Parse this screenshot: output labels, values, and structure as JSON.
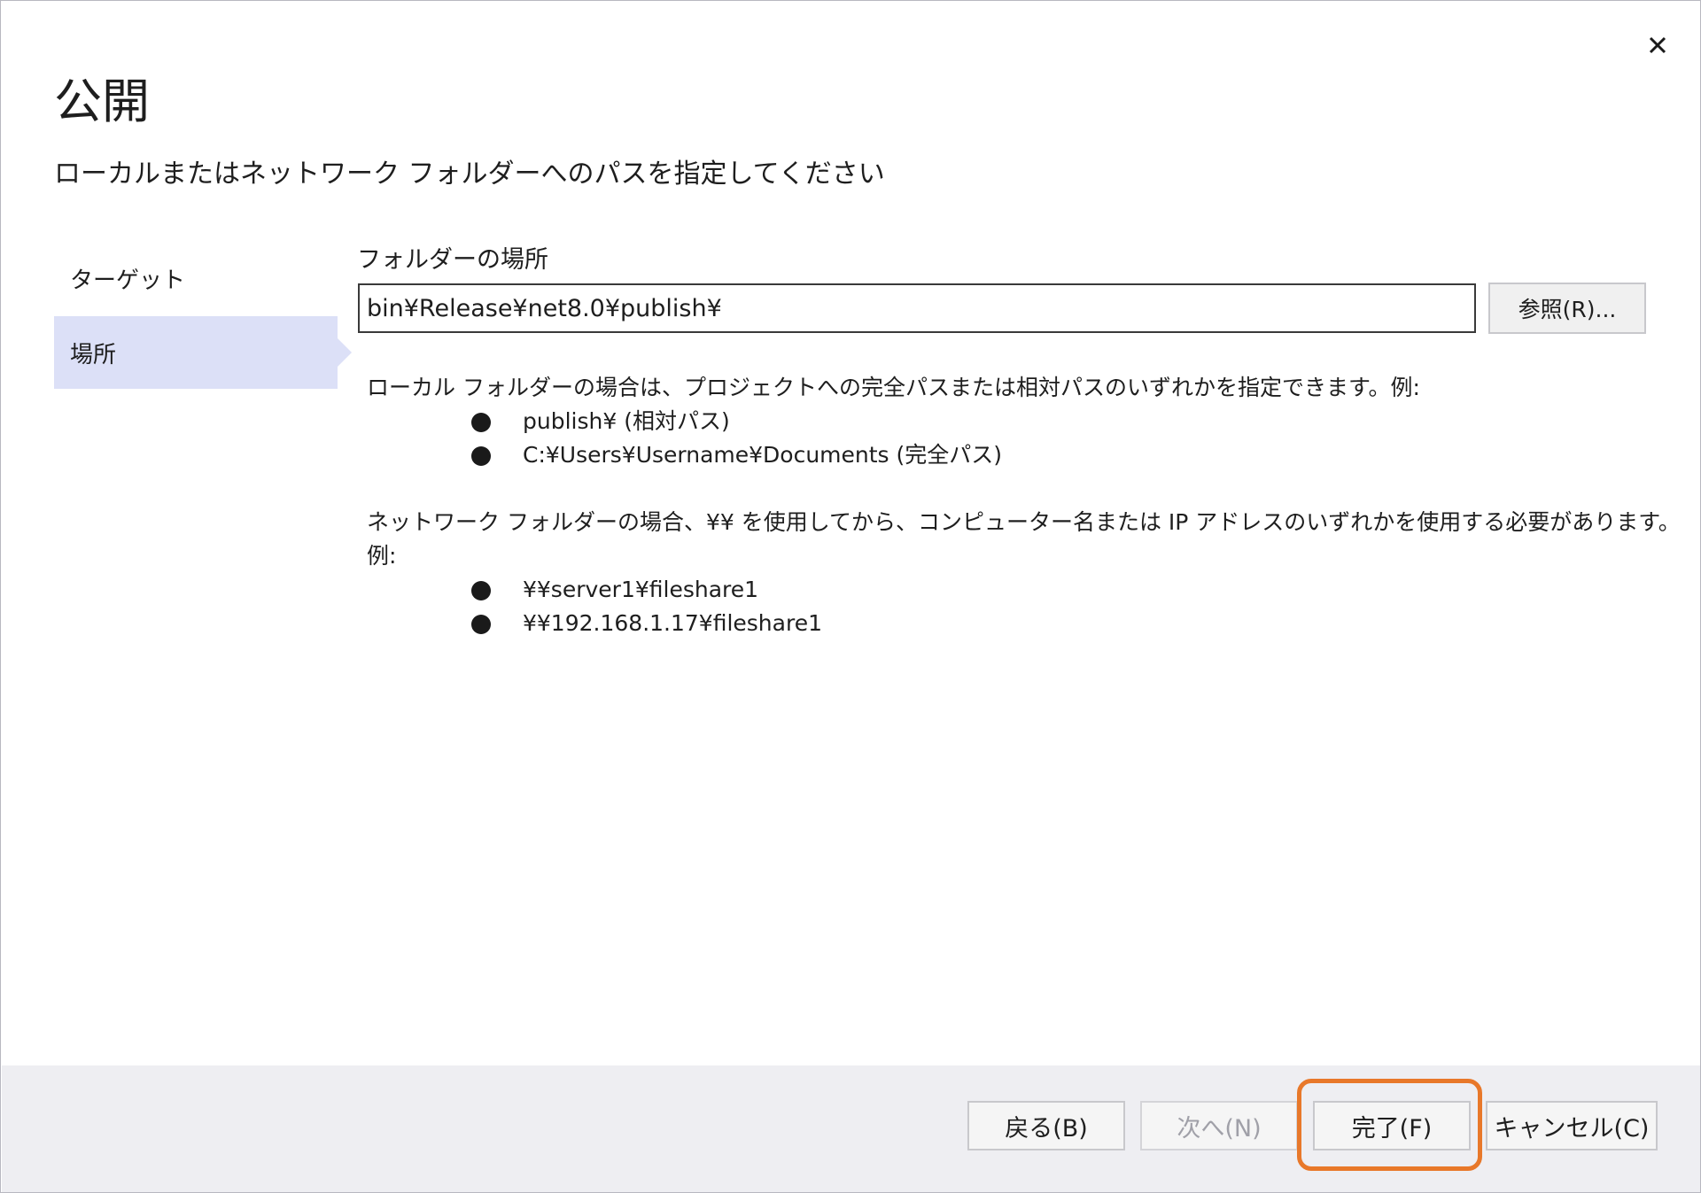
{
  "dialog": {
    "title": "公開",
    "subtitle": "ローカルまたはネットワーク フォルダーへのパスを指定してください"
  },
  "nav": {
    "items": [
      {
        "label": "ターゲット"
      },
      {
        "label": "場所",
        "selected": true
      }
    ]
  },
  "form": {
    "folder_label": "フォルダーの場所",
    "folder_value": "bin¥Release¥net8.0¥publish¥",
    "browse_label": "参照(R)..."
  },
  "help": {
    "local_intro": "ローカル フォルダーの場合は、プロジェクトへの完全パスまたは相対パスのいずれかを指定できます。例:",
    "local_examples": [
      "publish¥ (相対パス)",
      "C:¥Users¥Username¥Documents (完全パス)"
    ],
    "network_intro": "ネットワーク フォルダーの場合、¥¥ を使用してから、コンピューター名または IP アドレスのいずれかを使用する必要があります。例:",
    "network_examples": [
      "¥¥server1¥fileshare1",
      "¥¥192.168.1.17¥fileshare1"
    ]
  },
  "footer": {
    "back_label": "戻る(B)",
    "next_label": "次へ(N)",
    "finish_label": "完了(F)",
    "cancel_label": "キャンセル(C)"
  },
  "colors": {
    "selected_nav_bg": "#dce0f7",
    "footer_bg": "#eeeef2",
    "highlight": "#e8782a"
  },
  "icons": {
    "close": "close-icon"
  }
}
